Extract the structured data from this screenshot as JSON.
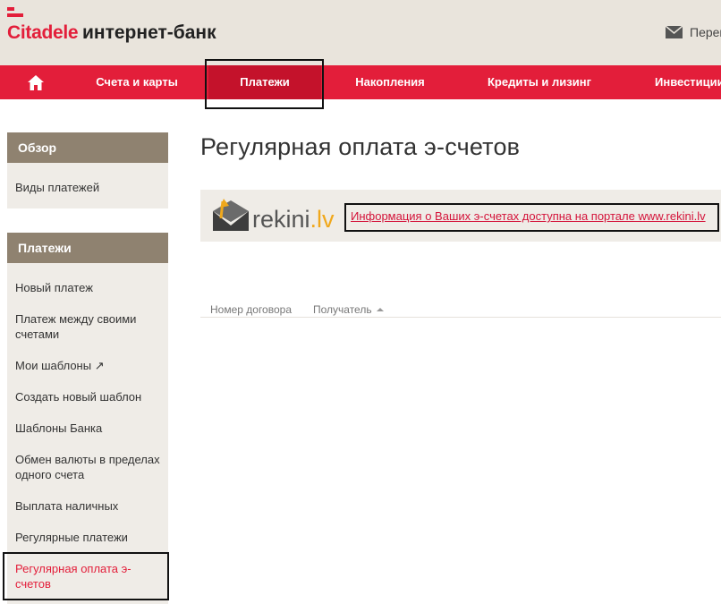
{
  "header": {
    "brand": "Citadele",
    "product": "интернет-банк",
    "mail_label": "Переп"
  },
  "nav": {
    "home_icon": "home-icon",
    "items": [
      {
        "label": "Счета и карты"
      },
      {
        "label": "Платежи",
        "active": true
      },
      {
        "label": "Накопления"
      },
      {
        "label": "Кредиты и лизинг"
      },
      {
        "label": "Инвестиции"
      }
    ]
  },
  "sidebar": {
    "overview": {
      "heading": "Обзор",
      "items": [
        {
          "label": "Виды платежей"
        }
      ]
    },
    "payments": {
      "heading": "Платежи",
      "items": [
        {
          "label": "Новый платеж"
        },
        {
          "label": "Платеж между своими счетами"
        },
        {
          "label": "Мои шаблоны ↗"
        },
        {
          "label": "Создать новый шаблон"
        },
        {
          "label": "Шаблоны Банка"
        },
        {
          "label": "Обмен валюты в пределах одного счета"
        },
        {
          "label": "Выплата наличных"
        },
        {
          "label": "Регулярные платежи"
        },
        {
          "label": "Регулярная оплата э-счетов",
          "active": true
        }
      ]
    }
  },
  "main": {
    "title": "Регулярная оплата э-счетов",
    "rekini": {
      "logo_word": "rekini",
      "logo_suffix": ".lv",
      "link_text": "Информация о Ваших э-счетах доступна на портале www.rekini.lv"
    },
    "table": {
      "columns": [
        {
          "label": "Номер договора"
        },
        {
          "label": "Получатель",
          "sorted": "asc"
        }
      ]
    }
  },
  "colors": {
    "accent_red": "#e31e3a",
    "active_nav": "#c4122b",
    "sidebar_head": "#8f8270",
    "panel_bg": "#efece7",
    "header_bg": "#e9e4dc",
    "rekini_orange": "#f0a81c"
  }
}
